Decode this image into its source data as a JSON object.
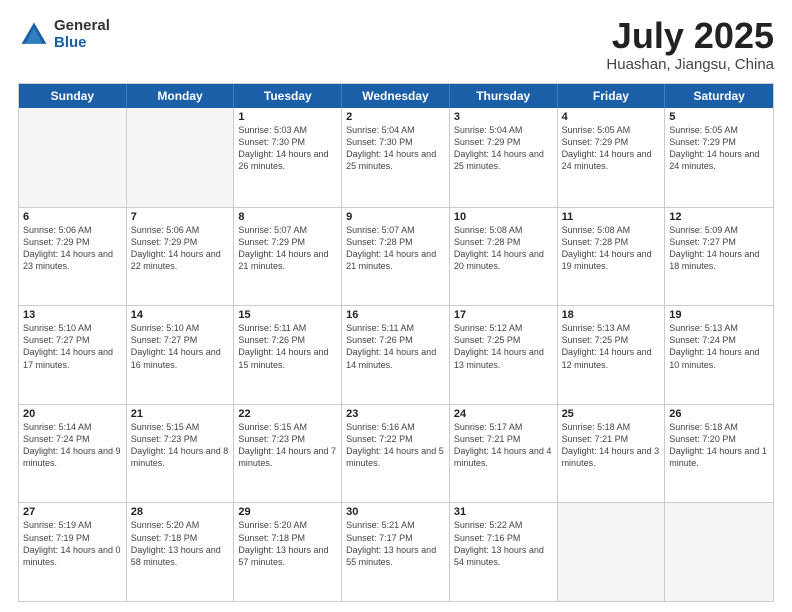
{
  "logo": {
    "general": "General",
    "blue": "Blue"
  },
  "title": {
    "month": "July 2025",
    "location": "Huashan, Jiangsu, China"
  },
  "header_days": [
    "Sunday",
    "Monday",
    "Tuesday",
    "Wednesday",
    "Thursday",
    "Friday",
    "Saturday"
  ],
  "weeks": [
    [
      {
        "day": "",
        "info": "",
        "empty": true
      },
      {
        "day": "",
        "info": "",
        "empty": true
      },
      {
        "day": "1",
        "info": "Sunrise: 5:03 AM\nSunset: 7:30 PM\nDaylight: 14 hours and 26 minutes."
      },
      {
        "day": "2",
        "info": "Sunrise: 5:04 AM\nSunset: 7:30 PM\nDaylight: 14 hours and 25 minutes."
      },
      {
        "day": "3",
        "info": "Sunrise: 5:04 AM\nSunset: 7:29 PM\nDaylight: 14 hours and 25 minutes."
      },
      {
        "day": "4",
        "info": "Sunrise: 5:05 AM\nSunset: 7:29 PM\nDaylight: 14 hours and 24 minutes."
      },
      {
        "day": "5",
        "info": "Sunrise: 5:05 AM\nSunset: 7:29 PM\nDaylight: 14 hours and 24 minutes."
      }
    ],
    [
      {
        "day": "6",
        "info": "Sunrise: 5:06 AM\nSunset: 7:29 PM\nDaylight: 14 hours and 23 minutes."
      },
      {
        "day": "7",
        "info": "Sunrise: 5:06 AM\nSunset: 7:29 PM\nDaylight: 14 hours and 22 minutes."
      },
      {
        "day": "8",
        "info": "Sunrise: 5:07 AM\nSunset: 7:29 PM\nDaylight: 14 hours and 21 minutes."
      },
      {
        "day": "9",
        "info": "Sunrise: 5:07 AM\nSunset: 7:28 PM\nDaylight: 14 hours and 21 minutes."
      },
      {
        "day": "10",
        "info": "Sunrise: 5:08 AM\nSunset: 7:28 PM\nDaylight: 14 hours and 20 minutes."
      },
      {
        "day": "11",
        "info": "Sunrise: 5:08 AM\nSunset: 7:28 PM\nDaylight: 14 hours and 19 minutes."
      },
      {
        "day": "12",
        "info": "Sunrise: 5:09 AM\nSunset: 7:27 PM\nDaylight: 14 hours and 18 minutes."
      }
    ],
    [
      {
        "day": "13",
        "info": "Sunrise: 5:10 AM\nSunset: 7:27 PM\nDaylight: 14 hours and 17 minutes."
      },
      {
        "day": "14",
        "info": "Sunrise: 5:10 AM\nSunset: 7:27 PM\nDaylight: 14 hours and 16 minutes."
      },
      {
        "day": "15",
        "info": "Sunrise: 5:11 AM\nSunset: 7:26 PM\nDaylight: 14 hours and 15 minutes."
      },
      {
        "day": "16",
        "info": "Sunrise: 5:11 AM\nSunset: 7:26 PM\nDaylight: 14 hours and 14 minutes."
      },
      {
        "day": "17",
        "info": "Sunrise: 5:12 AM\nSunset: 7:25 PM\nDaylight: 14 hours and 13 minutes."
      },
      {
        "day": "18",
        "info": "Sunrise: 5:13 AM\nSunset: 7:25 PM\nDaylight: 14 hours and 12 minutes."
      },
      {
        "day": "19",
        "info": "Sunrise: 5:13 AM\nSunset: 7:24 PM\nDaylight: 14 hours and 10 minutes."
      }
    ],
    [
      {
        "day": "20",
        "info": "Sunrise: 5:14 AM\nSunset: 7:24 PM\nDaylight: 14 hours and 9 minutes."
      },
      {
        "day": "21",
        "info": "Sunrise: 5:15 AM\nSunset: 7:23 PM\nDaylight: 14 hours and 8 minutes."
      },
      {
        "day": "22",
        "info": "Sunrise: 5:15 AM\nSunset: 7:23 PM\nDaylight: 14 hours and 7 minutes."
      },
      {
        "day": "23",
        "info": "Sunrise: 5:16 AM\nSunset: 7:22 PM\nDaylight: 14 hours and 5 minutes."
      },
      {
        "day": "24",
        "info": "Sunrise: 5:17 AM\nSunset: 7:21 PM\nDaylight: 14 hours and 4 minutes."
      },
      {
        "day": "25",
        "info": "Sunrise: 5:18 AM\nSunset: 7:21 PM\nDaylight: 14 hours and 3 minutes."
      },
      {
        "day": "26",
        "info": "Sunrise: 5:18 AM\nSunset: 7:20 PM\nDaylight: 14 hours and 1 minute."
      }
    ],
    [
      {
        "day": "27",
        "info": "Sunrise: 5:19 AM\nSunset: 7:19 PM\nDaylight: 14 hours and 0 minutes."
      },
      {
        "day": "28",
        "info": "Sunrise: 5:20 AM\nSunset: 7:18 PM\nDaylight: 13 hours and 58 minutes."
      },
      {
        "day": "29",
        "info": "Sunrise: 5:20 AM\nSunset: 7:18 PM\nDaylight: 13 hours and 57 minutes."
      },
      {
        "day": "30",
        "info": "Sunrise: 5:21 AM\nSunset: 7:17 PM\nDaylight: 13 hours and 55 minutes."
      },
      {
        "day": "31",
        "info": "Sunrise: 5:22 AM\nSunset: 7:16 PM\nDaylight: 13 hours and 54 minutes."
      },
      {
        "day": "",
        "info": "",
        "empty": true
      },
      {
        "day": "",
        "info": "",
        "empty": true
      }
    ]
  ]
}
